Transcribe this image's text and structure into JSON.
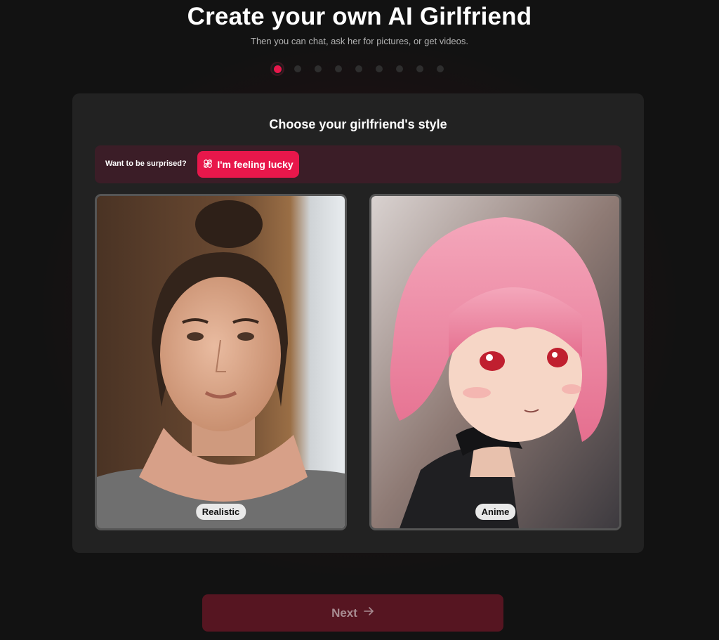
{
  "header": {
    "title": "Create your own AI Girlfriend",
    "subtitle": "Then you can chat, ask her for pictures, or get videos."
  },
  "progress": {
    "total_steps": 9,
    "current_step": 1
  },
  "style_step": {
    "heading": "Choose your girlfriend's style",
    "surprise_label": "Want to be surprised?",
    "lucky_button_label": "I'm feeling lucky",
    "lucky_icon": "clover-icon",
    "options": [
      {
        "label": "Realistic",
        "image": "realistic-portrait"
      },
      {
        "label": "Anime",
        "image": "anime-portrait"
      }
    ]
  },
  "footer": {
    "next_label": "Next",
    "next_icon": "arrow-right-icon"
  },
  "colors": {
    "accent": "#e8174b",
    "background": "#121212",
    "card": "#222222",
    "surprise_bar": "#3b1d27",
    "next_button": "#561521"
  }
}
